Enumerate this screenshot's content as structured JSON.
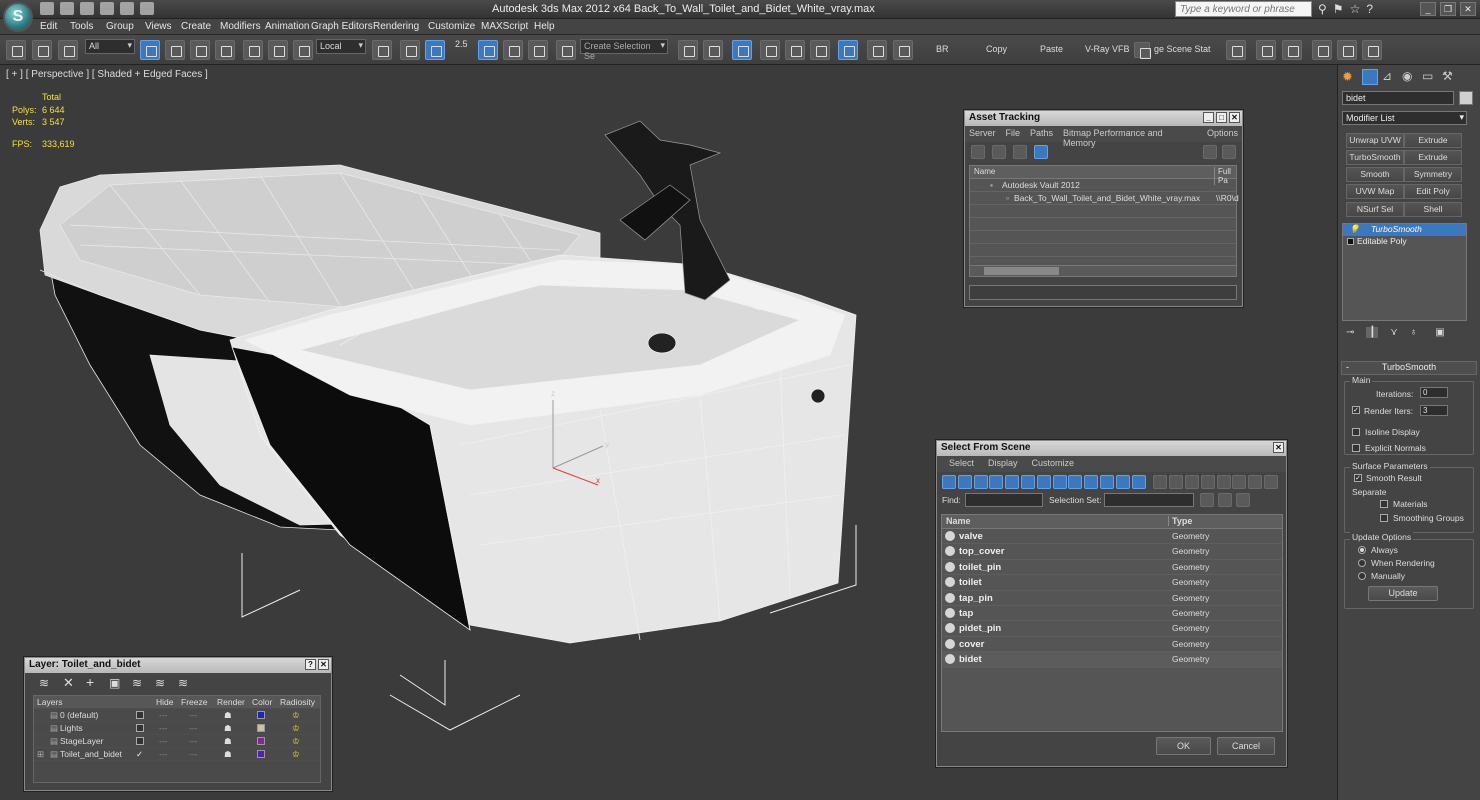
{
  "app": {
    "title": "Autodesk 3ds Max  2012 x64      Back_To_Wall_Toilet_and_Bidet_White_vray.max",
    "search_placeholder": "Type a keyword or phrase"
  },
  "menu": [
    "Edit",
    "Tools",
    "Group",
    "Views",
    "Create",
    "Modifiers",
    "Animation",
    "Graph Editors",
    "Rendering",
    "Customize",
    "MAXScript",
    "Help"
  ],
  "toolbar": {
    "filter": "All",
    "coord": "Local",
    "snap_value": "2.5",
    "selection_set_placeholder": "Create Selection Se",
    "labels": [
      "BR",
      "Copy",
      "Paste",
      "V-Ray VFB",
      "ge Scene Stat"
    ]
  },
  "viewport": {
    "label": "[ + ] [ Perspective ] [ Shaded + Edged Faces ]",
    "stats_header": "Total",
    "polys_label": "Polys:",
    "polys": "6 644",
    "verts_label": "Verts:",
    "verts": "3 547",
    "fps_label": "FPS:",
    "fps": "333,619",
    "axis_z": "z",
    "axis_y": "y",
    "axis_x": "x"
  },
  "asset_tracking": {
    "title": "Asset Tracking",
    "menu": [
      "Server",
      "File",
      "Paths",
      "Bitmap Performance and Memory",
      "Options"
    ],
    "col_name": "Name",
    "col_full": "Full Pa",
    "rows": [
      {
        "name": "Autodesk Vault 2012",
        "path": ""
      },
      {
        "name": "Back_To_Wall_Toilet_and_Bidet_White_vray.max",
        "path": "\\\\R0\\d"
      }
    ]
  },
  "select_from_scene": {
    "title": "Select From Scene",
    "menu": [
      "Select",
      "Display",
      "Customize"
    ],
    "find_label": "Find:",
    "selset_label": "Selection Set:",
    "col_name": "Name",
    "col_type": "Type",
    "rows": [
      {
        "name": "valve",
        "type": "Geometry"
      },
      {
        "name": "top_cover",
        "type": "Geometry"
      },
      {
        "name": "toilet_pin",
        "type": "Geometry"
      },
      {
        "name": "toilet",
        "type": "Geometry"
      },
      {
        "name": "tap_pin",
        "type": "Geometry"
      },
      {
        "name": "tap",
        "type": "Geometry"
      },
      {
        "name": "pidet_pin",
        "type": "Geometry"
      },
      {
        "name": "cover",
        "type": "Geometry"
      },
      {
        "name": "bidet",
        "type": "Geometry"
      }
    ],
    "ok": "OK",
    "cancel": "Cancel"
  },
  "layer": {
    "title": "Layer: Toilet_and_bidet",
    "cols": [
      "Layers",
      "Hide",
      "Freeze",
      "Render",
      "Color",
      "Radiosity"
    ],
    "rows": [
      {
        "name": "0 (default)",
        "color": "#2020c0"
      },
      {
        "name": "Lights",
        "color": "#c8c0a0"
      },
      {
        "name": "StageLayer",
        "color": "#9020a0"
      },
      {
        "name": "Toilet_and_bidet",
        "color": "#5020b0"
      }
    ]
  },
  "command_panel": {
    "object_name": "bidet",
    "modifier_list": "Modifier List",
    "mod_buttons": [
      "Unwrap UVW",
      "Extrude",
      "TurboSmooth",
      "Extrude",
      "Smooth",
      "Symmetry",
      "UVW Map",
      "Edit Poly",
      "NSurf Sel",
      "Shell"
    ],
    "stack": [
      "TurboSmooth",
      "Editable Poly"
    ],
    "rollout_title": "TurboSmooth",
    "main_label": "Main",
    "iterations_label": "Iterations:",
    "iterations": "0",
    "render_iters_label": "Render Iters:",
    "render_iters": "3",
    "isoline": "Isoline Display",
    "explicit": "Explicit Normals",
    "surface_label": "Surface Parameters",
    "smooth_result": "Smooth Result",
    "separate_label": "Separate",
    "materials": "Materials",
    "smoothing_groups": "Smoothing Groups",
    "update_label": "Update Options",
    "always": "Always",
    "when_rendering": "When Rendering",
    "manually": "Manually",
    "update_btn": "Update"
  },
  "colors": {
    "accent": "#3a78c2",
    "stats": "#f0e040",
    "viewport_bg": "#3b3b3b"
  }
}
